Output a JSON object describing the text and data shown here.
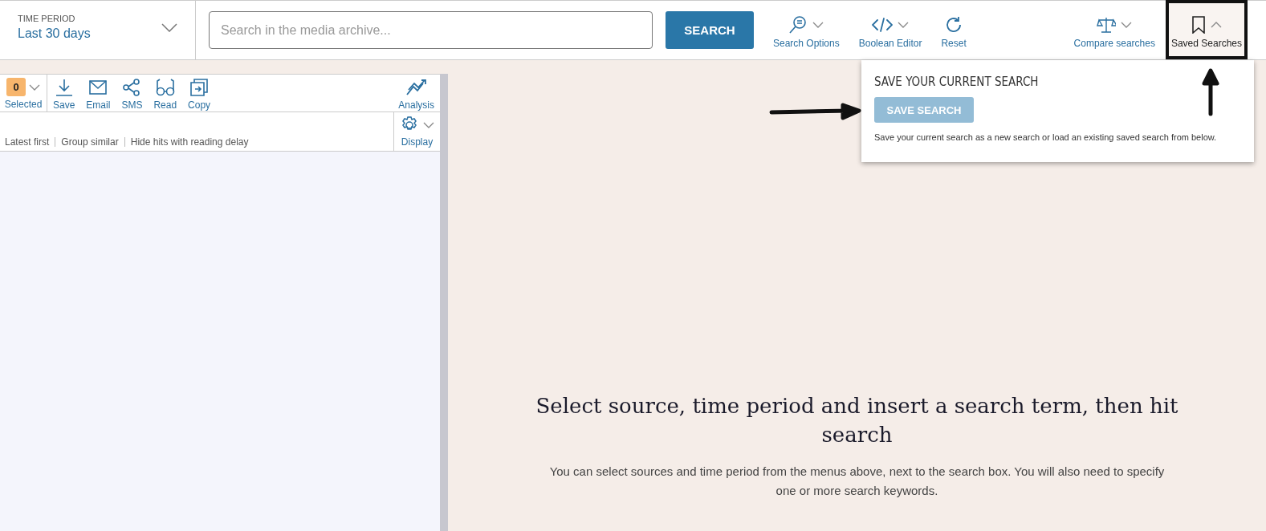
{
  "time_period": {
    "label": "TIME PERIOD",
    "value": "Last 30 days"
  },
  "search": {
    "placeholder": "Search in the media archive...",
    "button": "SEARCH"
  },
  "tools": [
    {
      "kind": "search-options",
      "label": "Search Options",
      "dropdown": true,
      "expanded": false
    },
    {
      "kind": "boolean-editor",
      "label": "Boolean Editor",
      "dropdown": true,
      "expanded": false
    },
    {
      "kind": "reset",
      "label": "Reset",
      "dropdown": false,
      "expanded": false
    }
  ],
  "right_tools": [
    {
      "kind": "compare",
      "label": "Compare searches",
      "dropdown": true,
      "expanded": false
    },
    {
      "kind": "saved",
      "label": "Saved Searches",
      "dropdown": true,
      "expanded": true
    }
  ],
  "saved_popover": {
    "title": "SAVE YOUR CURRENT SEARCH",
    "button": {
      "label": "SAVE SEARCH",
      "disabled": true
    },
    "text": "Save your current search as a new search or load an existing saved search from below."
  },
  "results": {
    "selected_count": "0",
    "selected_label": "Selected",
    "actions": [
      {
        "kind": "save",
        "label": "Save"
      },
      {
        "kind": "email",
        "label": "Email"
      },
      {
        "kind": "sms",
        "label": "SMS"
      },
      {
        "kind": "read",
        "label": "Read"
      },
      {
        "kind": "copy",
        "label": "Copy"
      }
    ],
    "analysis": "Analysis",
    "sort_options": [
      "Latest first",
      "Group similar",
      "Hide hits with reading delay"
    ],
    "display": "Display"
  },
  "message": {
    "title": "Select source, time period and insert a search term, then hit search",
    "text": "You can select sources and time period from the menus above, next to the search box. You will also need to specify one or more search keywords."
  }
}
